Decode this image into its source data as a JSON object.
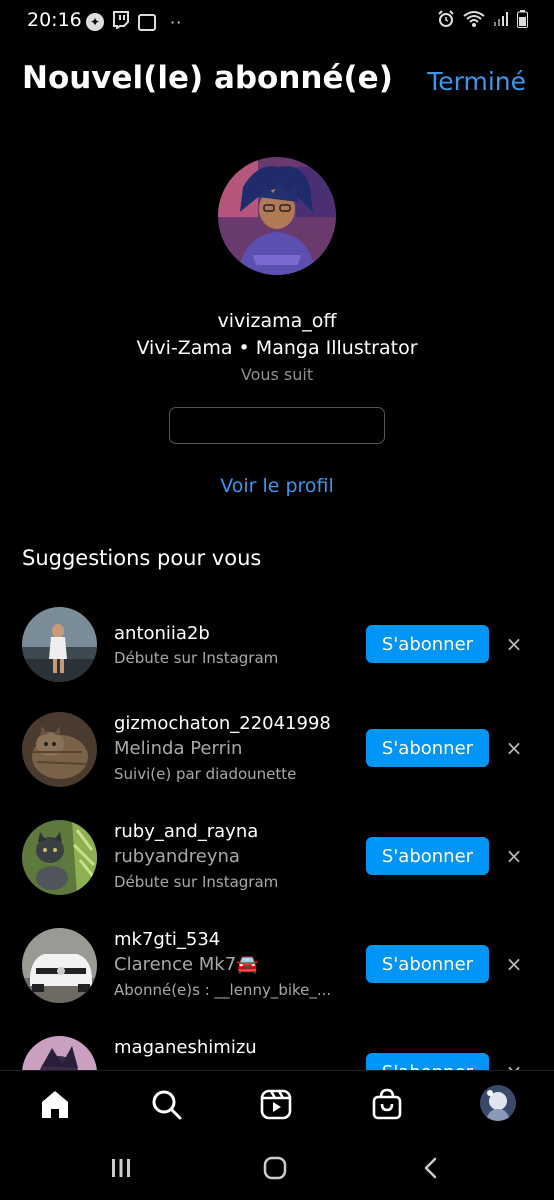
{
  "status_bar": {
    "time": "20:16",
    "more": "··"
  },
  "header": {
    "title": "Nouvel(le) abonné(e)",
    "done_label": "Terminé"
  },
  "profile": {
    "username": "vivizama_off",
    "fullname": "Vivi-Zama • Manga Illustrator",
    "follows_you": "Vous suit",
    "follow_back_label": "",
    "view_profile_label": "Voir le profil"
  },
  "suggestions": {
    "title": "Suggestions pour vous",
    "follow_label": "S'abonner",
    "dismiss_icon": "×",
    "items": [
      {
        "username": "antoniia2b",
        "fullname": "",
        "subtitle": "Débute sur Instagram"
      },
      {
        "username": "gizmochaton_22041998",
        "fullname": "Melinda Perrin",
        "subtitle": "Suivi(e) par diadounette"
      },
      {
        "username": "ruby_and_rayna",
        "fullname": "rubyandreyna",
        "subtitle": "Débute sur Instagram"
      },
      {
        "username": "mk7gti_534",
        "fullname": "Clarence Mk7🚘",
        "subtitle": "Abonné(e)s : __lenny_bike_..."
      },
      {
        "username": "maganeshimizu",
        "fullname": "",
        "subtitle": ""
      }
    ]
  },
  "colors": {
    "accent": "#3897f0",
    "follow_button": "#0095f6",
    "background": "#000000"
  }
}
